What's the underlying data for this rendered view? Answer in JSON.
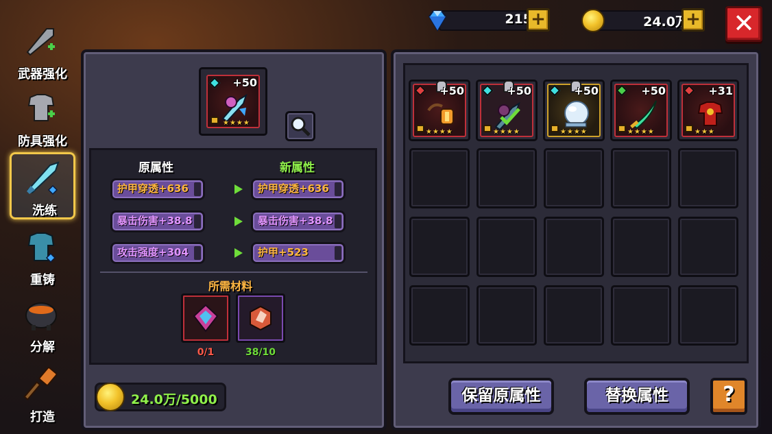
{
  "currency": {
    "gems": "215",
    "gold": "24.0万",
    "gem_plus": "+",
    "gold_plus": "+"
  },
  "close_label": "✕",
  "nav": {
    "items": [
      {
        "label": "武器强化",
        "icon": "sword-icon"
      },
      {
        "label": "防具强化",
        "icon": "armor-icon"
      },
      {
        "label": "洗练",
        "icon": "crystal-sword-icon"
      },
      {
        "label": "重铸",
        "icon": "vest-icon"
      },
      {
        "label": "分解",
        "icon": "cauldron-icon"
      },
      {
        "label": "打造",
        "icon": "hammer-icon"
      }
    ],
    "active_index": 2
  },
  "selected_item": {
    "level": "+50",
    "stars": "★★★★",
    "icon": "crystal-staff-icon"
  },
  "magnify_icon": "magnify-icon",
  "attributes": {
    "old_header": "原属性",
    "new_header": "新属性",
    "rows": [
      {
        "old": "护甲穿透+636",
        "new": "护甲穿透+636",
        "old_color": "orange",
        "new_color": "orange"
      },
      {
        "old": "暴击伤害+38.8",
        "new": "暴击伤害+38.8",
        "old_color": "purple",
        "new_color": "purple"
      },
      {
        "old": "攻击强度+304",
        "new": "护甲+523",
        "old_color": "purple",
        "new_color": "orange"
      }
    ]
  },
  "materials": {
    "header": "所需材料",
    "items": [
      {
        "count": "0/1",
        "icon": "crystal-shard-icon",
        "count_color": "#ff5a4a"
      },
      {
        "count": "38/10",
        "icon": "red-gem-icon",
        "count_color": "#6fdd3a"
      }
    ]
  },
  "cost": "24.0万/5000",
  "inventory": [
    {
      "level": "+50",
      "stars": "★★★★",
      "icon": "lantern-staff-icon",
      "frame": "red"
    },
    {
      "level": "+50",
      "stars": "★★★★",
      "icon": "crystal-staff-icon",
      "frame": "red",
      "selected": true
    },
    {
      "level": "+50",
      "stars": "★★★★",
      "icon": "ice-orb-icon",
      "frame": "gold"
    },
    {
      "level": "+50",
      "stars": "★★★★",
      "icon": "green-blade-icon",
      "frame": "red"
    },
    {
      "level": "+31",
      "stars": "★★★",
      "icon": "fire-armor-icon",
      "frame": "red"
    }
  ],
  "buttons": {
    "keep": "保留原属性",
    "replace": "替换属性",
    "help": "?"
  }
}
